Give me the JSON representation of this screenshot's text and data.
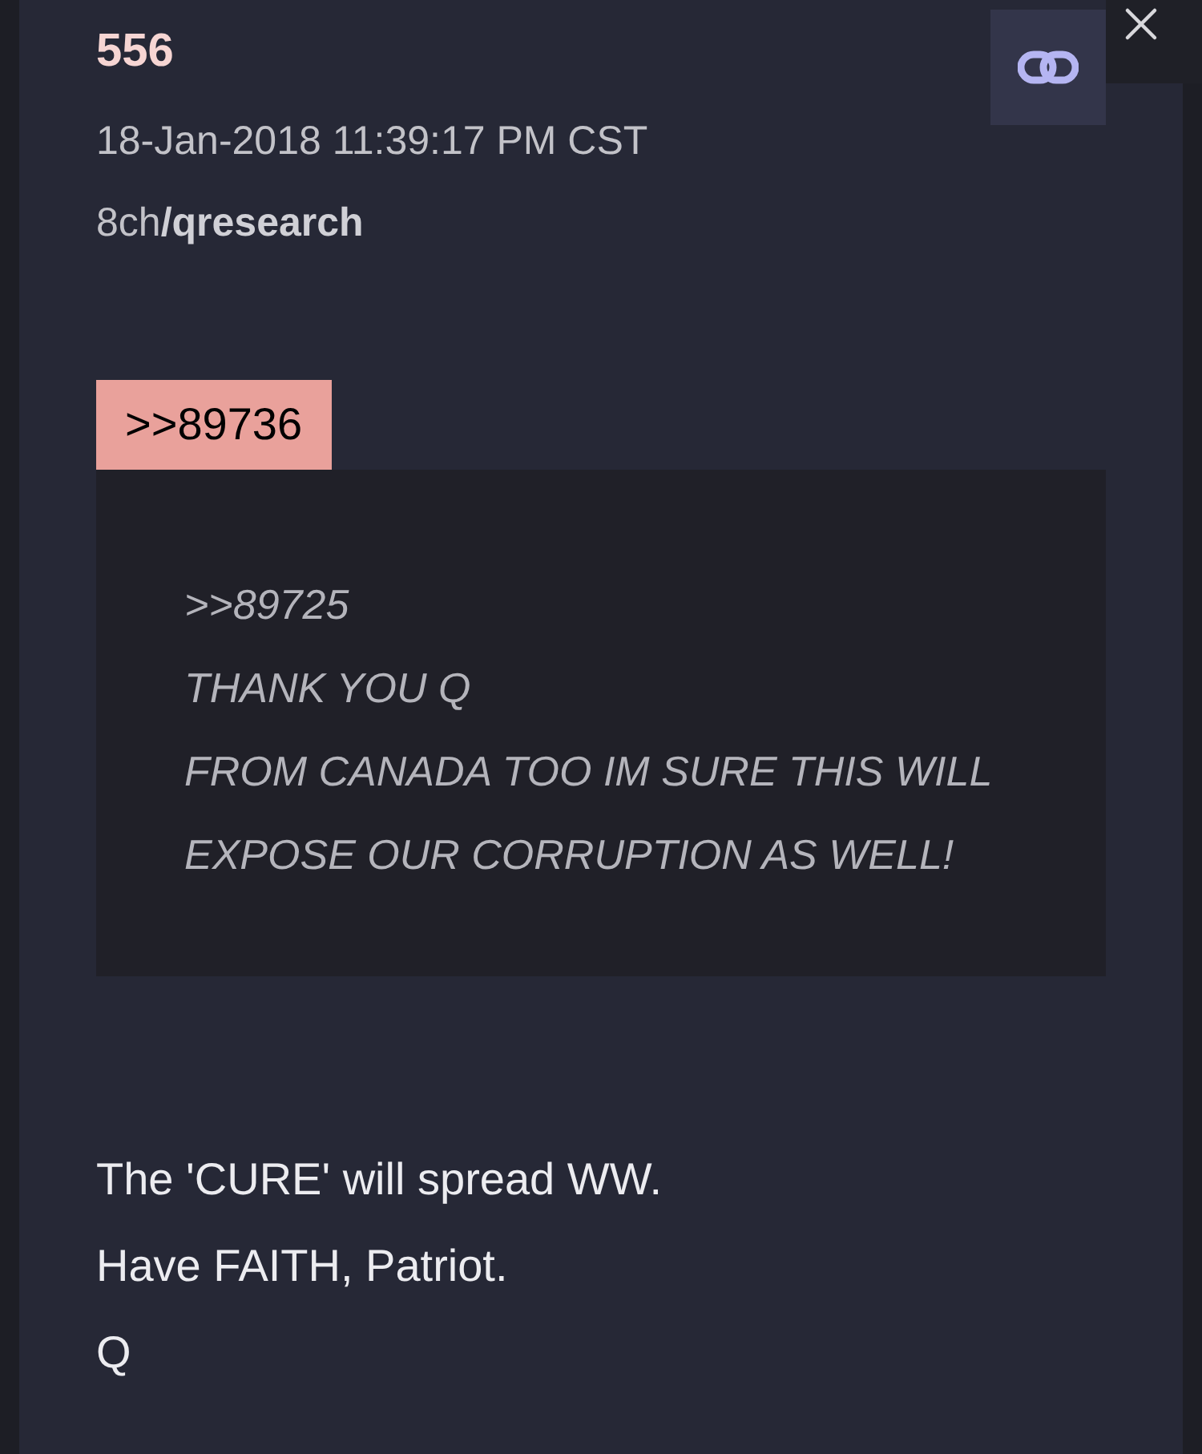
{
  "post": {
    "number": "556",
    "timestamp": "18-Jan-2018 11:39:17 PM CST",
    "source": {
      "site": "8ch",
      "board": "/qresearch"
    }
  },
  "reply_link": ">>89736",
  "quote": {
    "lines": [
      ">>89725",
      "THANK YOU Q",
      "FROM CANADA TOO IM SURE THIS WILL",
      "EXPOSE OUR CORRUPTION AS WELL!"
    ]
  },
  "body": [
    "The 'CURE' will spread WW.",
    "Have FAITH, Patriot.",
    "Q"
  ]
}
